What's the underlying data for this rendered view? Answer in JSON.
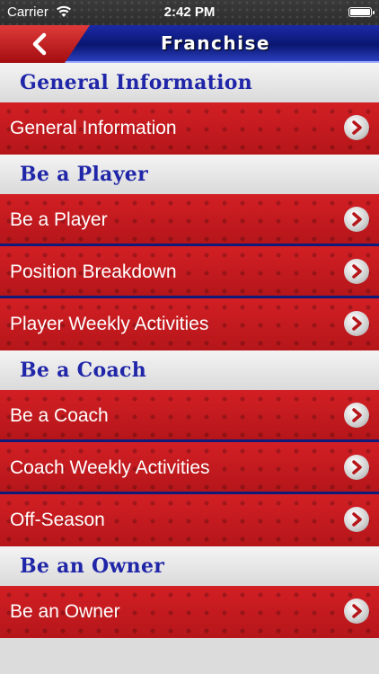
{
  "status_bar": {
    "carrier": "Carrier",
    "time": "2:42 PM"
  },
  "nav": {
    "title": "Franchise",
    "back_icon": "chevron-left-icon"
  },
  "sections": [
    {
      "header": "General Information",
      "items": [
        "General Information"
      ]
    },
    {
      "header": "Be a Player",
      "items": [
        "Be a Player",
        "Position Breakdown",
        "Player Weekly Activities"
      ]
    },
    {
      "header": "Be a Coach",
      "items": [
        "Be a Coach",
        "Coach Weekly Activities",
        "Off-Season"
      ]
    },
    {
      "header": "Be an Owner",
      "items": [
        "Be an Owner"
      ]
    }
  ],
  "colors": {
    "row_red": "#c41a1e",
    "header_text_blue": "#2026a8",
    "nav_blue": "#0a1670",
    "divider_blue": "#0f1a7a"
  }
}
